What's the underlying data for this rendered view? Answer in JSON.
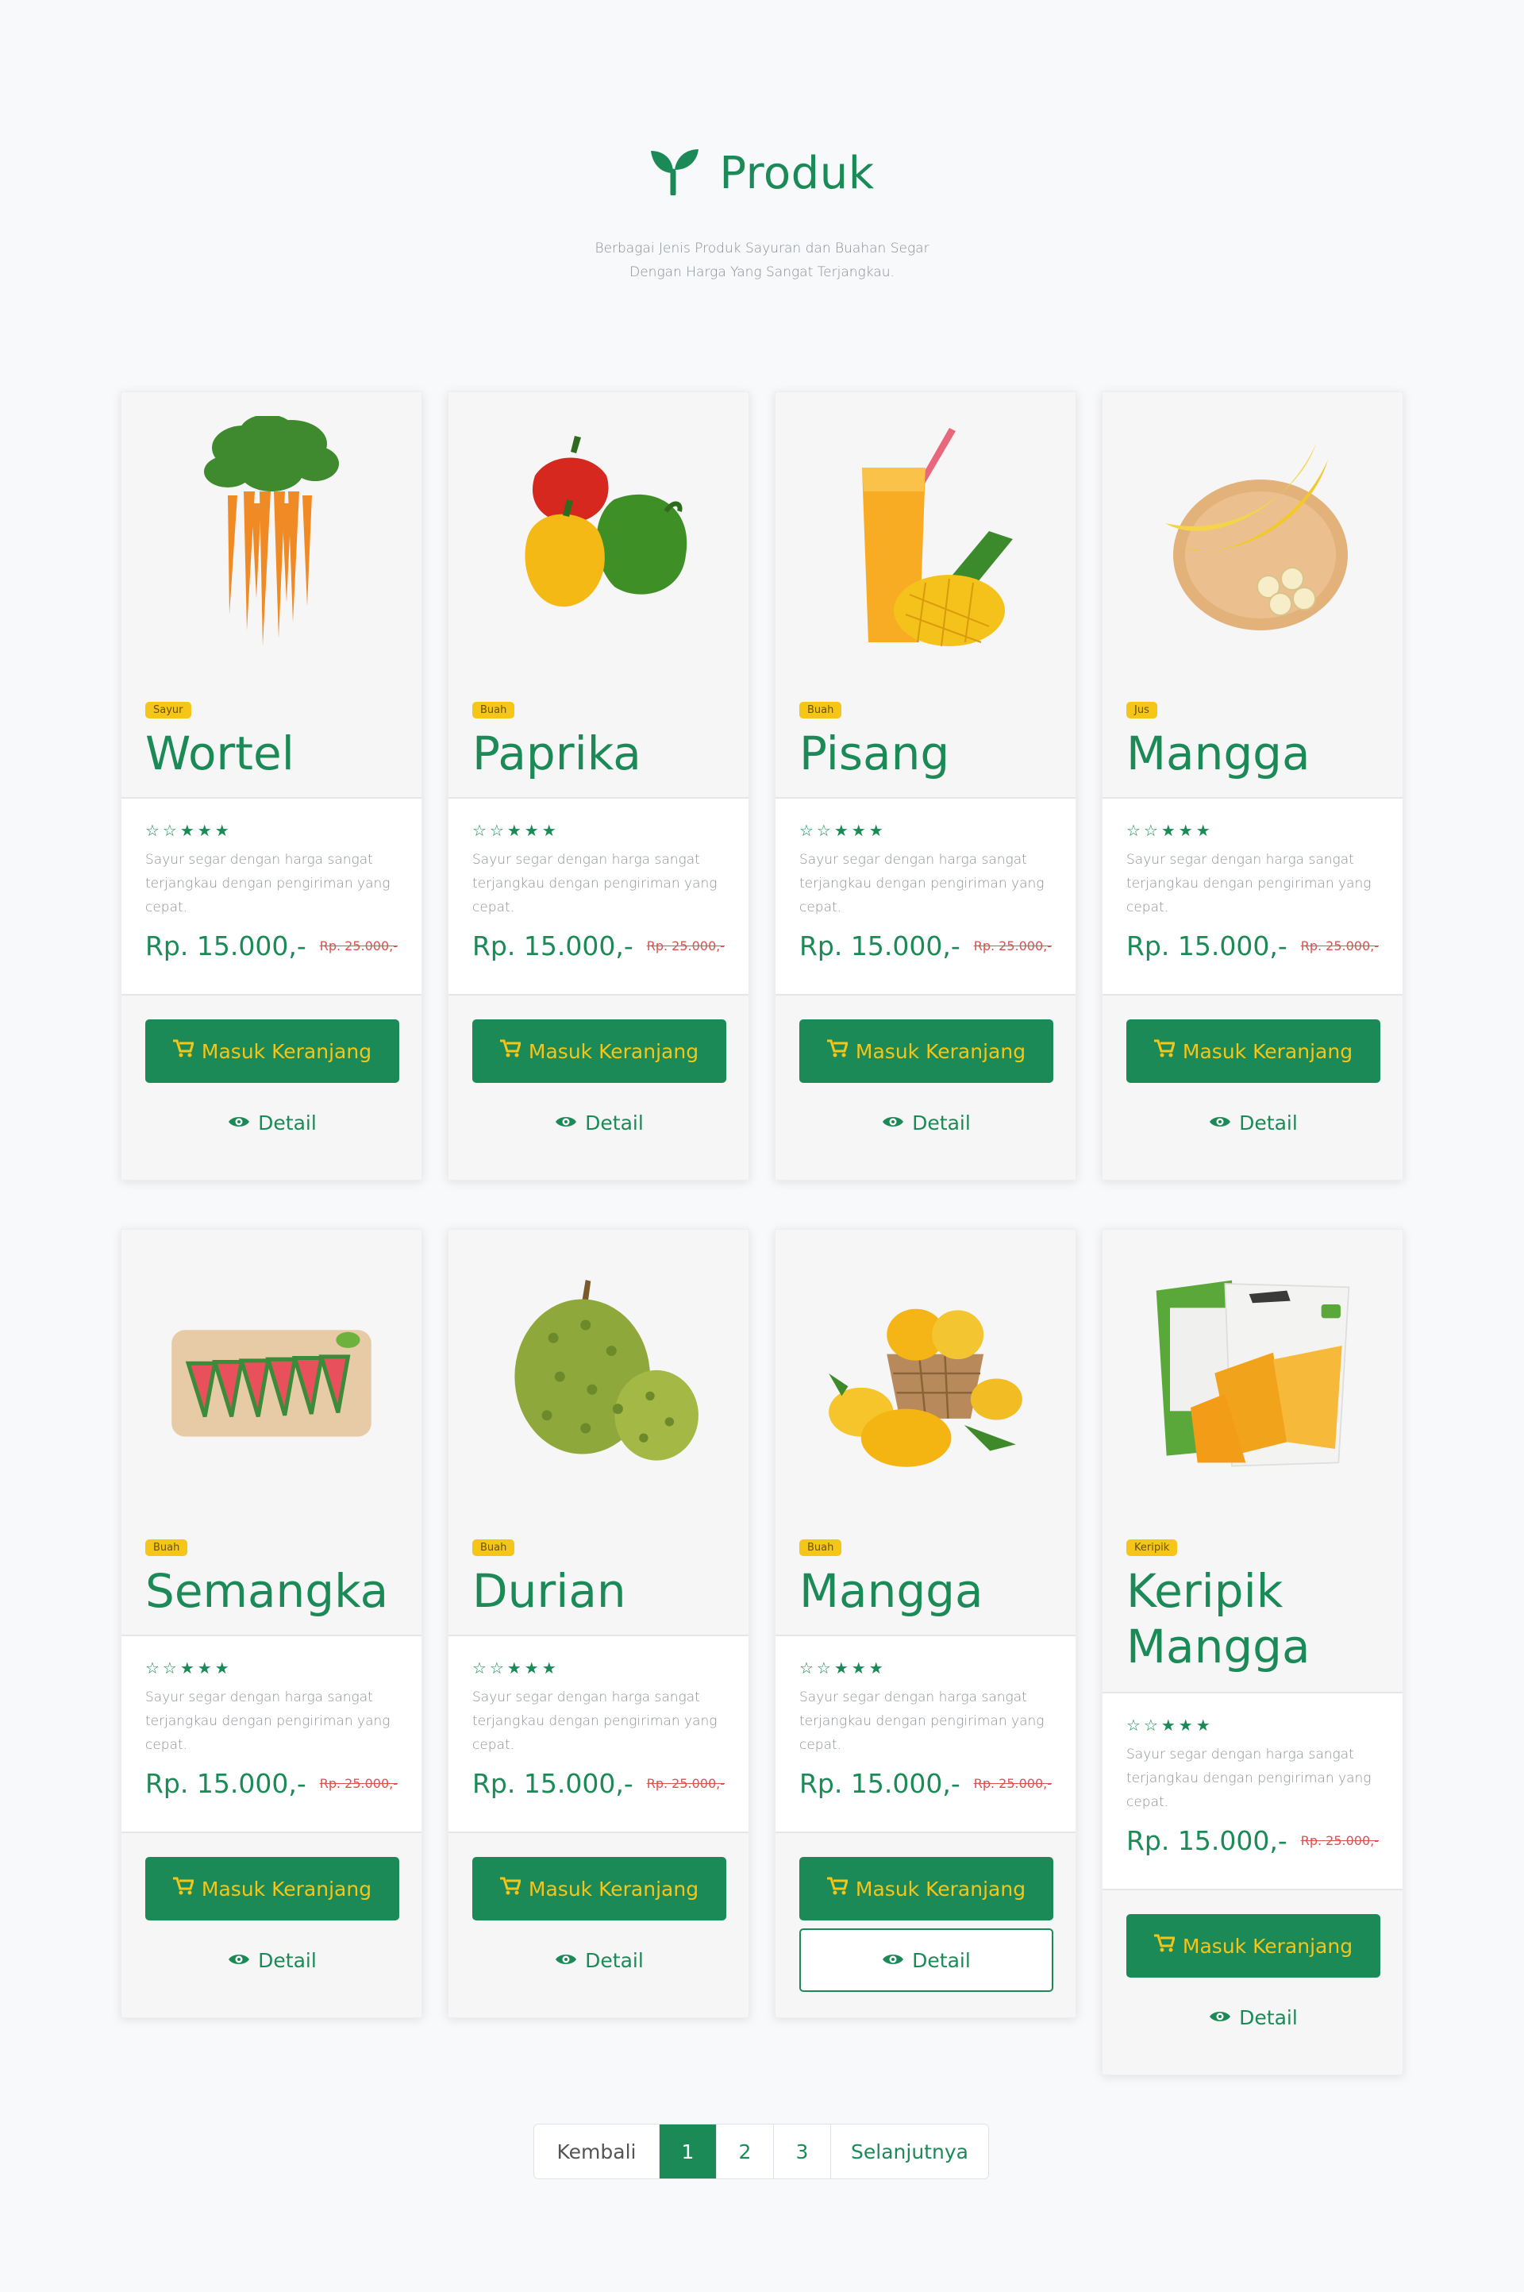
{
  "header": {
    "title": "Produk",
    "subtitle_line1": "Berbagai Jenis Produk Sayuran dan Buahan Segar",
    "subtitle_line2": "Dengan Harga Yang Sangat Terjangkau."
  },
  "colors": {
    "primary": "#1b8a57",
    "accent": "#f5c518",
    "strike": "#d9534f"
  },
  "common": {
    "stars": "☆☆★★★",
    "desc": "Sayur segar dengan harga sangat terjangkau dengan pengiriman yang cepat.",
    "price": "Rp. 15.000,-",
    "old_price": "Rp. 25.000,-",
    "cart_label": "Masuk Keranjang",
    "detail_label": "Detail"
  },
  "products": [
    {
      "badge": "Sayur",
      "name": "Wortel",
      "image": "carrot-image"
    },
    {
      "badge": "Buah",
      "name": "Paprika",
      "image": "bell-pepper-image"
    },
    {
      "badge": "Buah",
      "name": "Pisang",
      "image": "mango-juice-image"
    },
    {
      "badge": "Jus",
      "name": "Mangga",
      "image": "banana-plate-image"
    },
    {
      "badge": "Buah",
      "name": "Semangka",
      "image": "watermelon-image"
    },
    {
      "badge": "Buah",
      "name": "Durian",
      "image": "durian-image"
    },
    {
      "badge": "Buah",
      "name": "Mangga",
      "image": "mango-basket-image"
    },
    {
      "badge": "Keripik",
      "name": "Keripik Mangga",
      "image": "mango-chips-image"
    }
  ],
  "pagination": {
    "prev": "Kembali",
    "pages": [
      "1",
      "2",
      "3"
    ],
    "active": "1",
    "next": "Selanjutnya"
  }
}
